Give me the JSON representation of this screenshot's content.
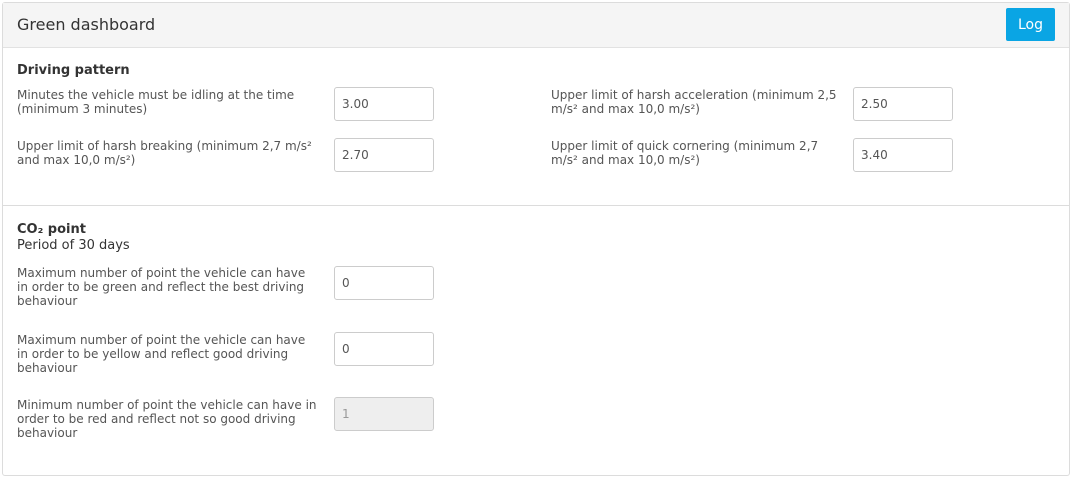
{
  "header": {
    "title": "Green dashboard",
    "log_button": "Log"
  },
  "driving_pattern": {
    "title": "Driving pattern",
    "fields": [
      {
        "label": "Minutes the vehicle must be idling at the time (minimum 3 minutes)",
        "value": "3.00"
      },
      {
        "label": "Upper limit of harsh acceleration (minimum 2,5 m/s² and max 10,0 m/s²)",
        "value": "2.50"
      },
      {
        "label": "Upper limit of harsh breaking (minimum 2,7 m/s² and max 10,0 m/s²)",
        "value": "2.70"
      },
      {
        "label": "Upper limit of quick cornering (minimum 2,7 m/s² and max 10,0 m/s²)",
        "value": "3.40"
      }
    ]
  },
  "co2_point": {
    "title": "CO₂ point",
    "subtitle": "Period of 30 days",
    "fields": [
      {
        "label": "Maximum number of point the vehicle can have in order to be green and reflect the best driving behaviour",
        "value": "0",
        "disabled": false
      },
      {
        "label": "Maximum number of point the vehicle can have in order to be yellow and reflect good driving behaviour",
        "value": "0",
        "disabled": false
      },
      {
        "label": "Minimum number of point the vehicle can have in order to be red and reflect not so good driving behaviour",
        "value": "1",
        "disabled": true
      }
    ]
  },
  "colors": {
    "accent": "#0aa5e4",
    "header_bg": "#f5f5f5",
    "disabled_bg": "#eeeeee"
  }
}
